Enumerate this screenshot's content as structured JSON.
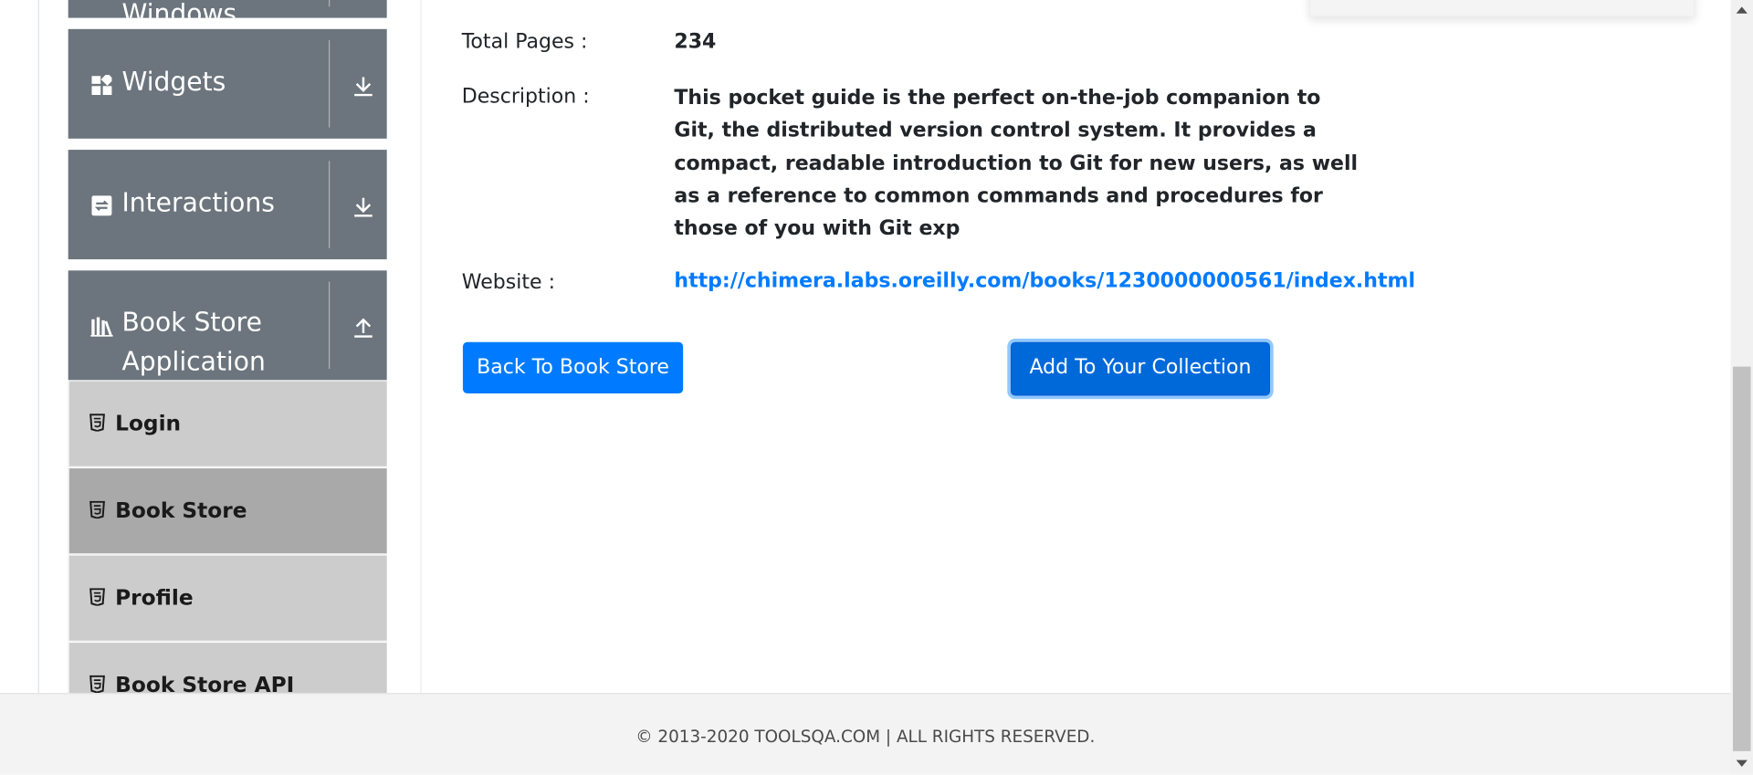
{
  "sidebar": {
    "groups": [
      {
        "title": "Windows",
        "icon": "window-icon",
        "arrow": "download-arrow-icon"
      },
      {
        "title": "Widgets",
        "icon": "widgets-icon",
        "arrow": "download-arrow-icon"
      },
      {
        "title": "Interactions",
        "icon": "interactions-icon",
        "arrow": "download-arrow-icon"
      },
      {
        "title_line1": "Book Store",
        "title_line2": "Application",
        "icon": "books-icon",
        "arrow": "upload-arrow-icon"
      }
    ],
    "items": [
      {
        "label": "Login",
        "icon": "html5-icon"
      },
      {
        "label": "Book Store",
        "icon": "html5-icon"
      },
      {
        "label": "Profile",
        "icon": "html5-icon"
      },
      {
        "label": "Book Store API",
        "icon": "html5-icon"
      }
    ]
  },
  "book": {
    "total_pages_label": "Total Pages :",
    "total_pages_value": "234",
    "description_label": "Description :",
    "description_lines": [
      "This pocket guide is the perfect on-the-job companion to",
      "Git, the distributed version control system. It provides a",
      "compact, readable introduction to Git for new users, as well",
      "as a reference to common commands and procedures for",
      "those of you with Git exp"
    ],
    "website_label": "Website :",
    "website_value": "http://chimera.labs.oreilly.com/books/1230000000561/index.html"
  },
  "actions": {
    "back_label": "Back To Book Store",
    "add_label": "Add To Your Collection"
  },
  "footer": {
    "text": "© 2013-2020 TOOLSQA.COM | ALL RIGHTS RESERVED."
  },
  "colors": {
    "accent": "#007bff",
    "sidebar_group": "#6c757d",
    "sidebar_item": "#cccccc",
    "sidebar_item_active": "#a9a9a9"
  }
}
